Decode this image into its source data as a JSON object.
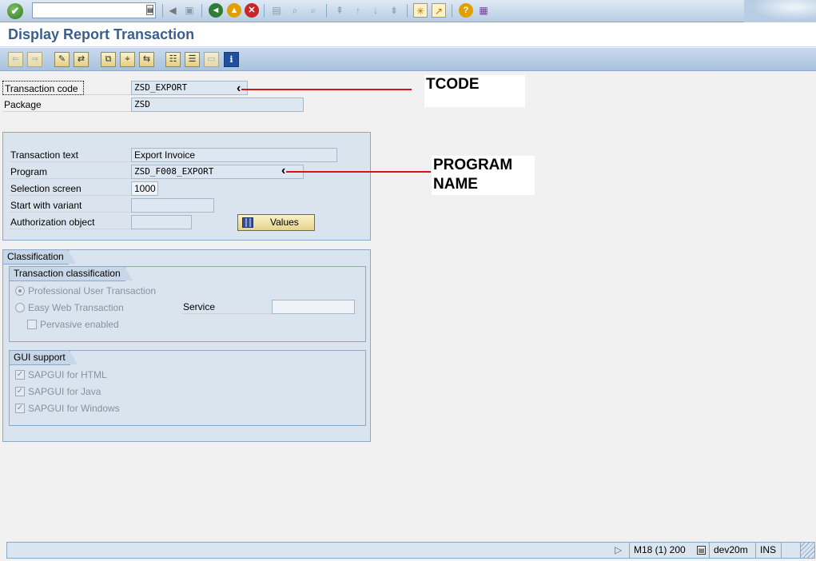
{
  "title": "Display Report Transaction",
  "toolbar": {
    "command_field_value": "",
    "icons": [
      "enter-icon",
      "save-icon",
      "back-icon",
      "exit-icon",
      "cancel-icon",
      "print-icon",
      "find-icon",
      "find-next-icon",
      "first-page-icon",
      "prev-page-icon",
      "next-page-icon",
      "last-page-icon",
      "create-session-icon",
      "shortcut-icon",
      "help-icon",
      "layout-icon"
    ]
  },
  "app_toolbar": {
    "icons": [
      "back-arrow-icon",
      "forward-arrow-icon",
      "change-icon",
      "display-change-icon",
      "other-object-icon",
      "where-used-icon",
      "navigate-icon",
      "hierarchy-icon",
      "print-list-icon",
      "object-list-icon",
      "info-icon"
    ]
  },
  "header_fields": {
    "tcode_label": "Transaction code",
    "tcode_value": "ZSD_EXPORT",
    "package_label": "Package",
    "package_value": "ZSD"
  },
  "program_group": {
    "text_label": "Transaction text",
    "text_value": "Export Invoice",
    "program_label": "Program",
    "program_value": "ZSD_F008_EXPORT",
    "sel_label": "Selection screen",
    "sel_value": "1000",
    "variant_label": "Start with variant",
    "variant_value": "",
    "auth_label": "Authorization object",
    "auth_value": "",
    "values_button": "Values"
  },
  "classification": {
    "title": "Classification",
    "tc_title": "Transaction classification",
    "professional": "Professional User Transaction",
    "easy_web": "Easy Web Transaction",
    "service_label": "Service",
    "service_value": "",
    "pervasive": "Pervasive enabled",
    "professional_selected": true,
    "easy_web_selected": false,
    "pervasive_checked": false
  },
  "gui_support": {
    "title": "GUI support",
    "html": "SAPGUI for HTML",
    "java": "SAPGUI for Java",
    "windows": "SAPGUI for Windows",
    "html_checked": true,
    "java_checked": true,
    "windows_checked": true
  },
  "annotations": {
    "tcode": "TCODE",
    "program_line1": "PROGRAM",
    "program_line2": "NAME",
    "arrow_color": "#d4141b"
  },
  "status_bar": {
    "system": "M18 (1) 200",
    "server": "dev20m",
    "mode": "INS"
  }
}
